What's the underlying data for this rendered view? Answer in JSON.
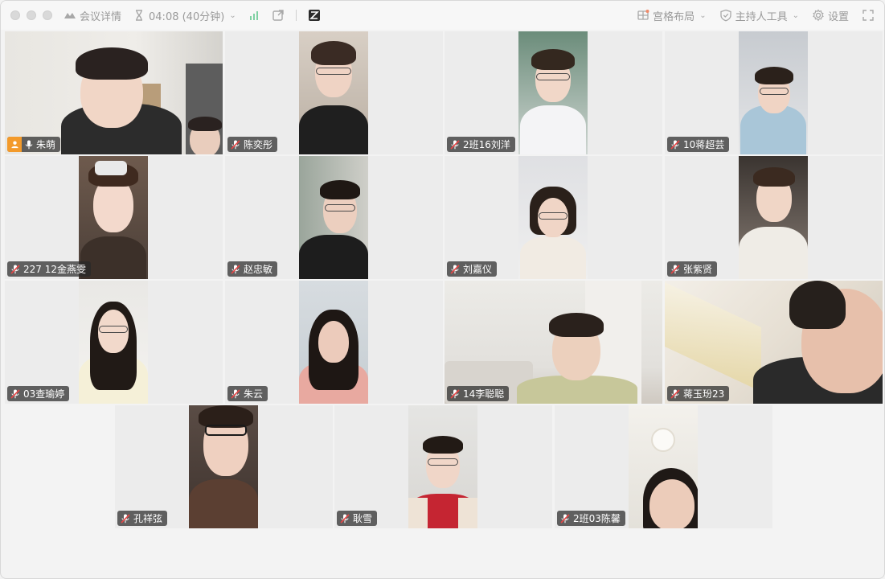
{
  "toolbar": {
    "meeting_details": "会议详情",
    "timer": "04:08 (40分钟)",
    "layout": "宫格布局",
    "host_tools": "主持人工具",
    "settings": "设置"
  },
  "participants": [
    {
      "name": "朱萌",
      "muted": false,
      "host": true
    },
    {
      "name": "陈奕彤",
      "muted": true
    },
    {
      "name": "2班16刘洋",
      "muted": true
    },
    {
      "name": "10蒋超芸",
      "muted": true
    },
    {
      "name": "227 12金燕雯",
      "muted": true
    },
    {
      "name": "赵忠敏",
      "muted": true
    },
    {
      "name": "刘嘉仪",
      "muted": true
    },
    {
      "name": "张紫贤",
      "muted": true
    },
    {
      "name": "03查瑜婷",
      "muted": true
    },
    {
      "name": "朱云",
      "muted": true
    },
    {
      "name": "14李聪聪",
      "muted": true
    },
    {
      "name": "蒋玉玢23",
      "muted": true
    },
    {
      "name": "孔祥弦",
      "muted": true
    },
    {
      "name": "耿雪",
      "muted": true
    },
    {
      "name": "2班03陈馨",
      "muted": true
    }
  ],
  "colors": {
    "active_border": "#6bc79a",
    "host_badge": "#f39a2b"
  }
}
